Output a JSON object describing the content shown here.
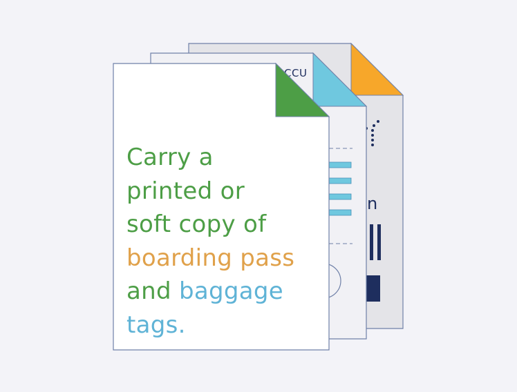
{
  "colors": {
    "background": "#f3f3f8",
    "sheet_stroke": "#6f80a8",
    "back_sheet_fill": "#e4e4e8",
    "mid_sheet_fill": "#f1f1f5",
    "front_sheet_fill": "#ffffff",
    "orange_corner": "#f7a72a",
    "blue_corner": "#6fc8df",
    "green_corner": "#4d9e46",
    "navy": "#1e2e5e",
    "text_green": "#4d9e46",
    "text_orange": "#e0a14a",
    "text_blue": "#5fb3d6"
  },
  "icons": {
    "back_sheet_corner": "orange-folded-corner-icon",
    "mid_sheet_corner": "blue-folded-corner-icon",
    "front_sheet_corner": "green-folded-corner-icon",
    "plane_path": "dotted-flight-path-icon",
    "barcode": "barcode-bars-icon",
    "stamp": "circular-stamp-icon"
  },
  "mid_sheet": {
    "code_label": "CCU"
  },
  "back_sheet": {
    "big_letter": "n"
  },
  "message": {
    "line1": "Carry a",
    "line2": "printed or",
    "line3": "soft copy of",
    "line4_highlight": "boarding pass",
    "line5_prefix": "and ",
    "line5_highlight": "baggage",
    "line6_highlight": "tags."
  }
}
